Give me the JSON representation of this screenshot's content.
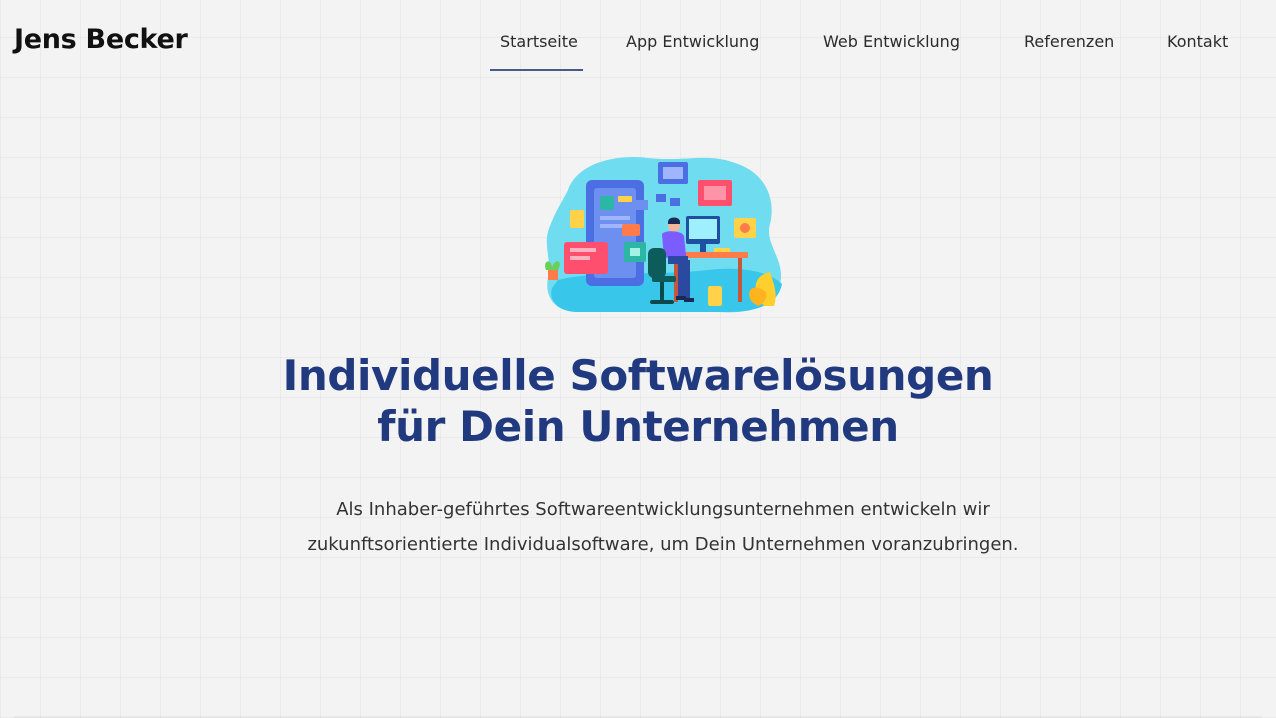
{
  "brand": {
    "name": "Jens Becker"
  },
  "nav": {
    "items": [
      {
        "label": "Startseite",
        "active": true
      },
      {
        "label": "App Entwicklung",
        "active": false
      },
      {
        "label": "Web Entwicklung",
        "active": false
      },
      {
        "label": "Referenzen",
        "active": false
      },
      {
        "label": "Kontakt",
        "active": false
      }
    ]
  },
  "hero": {
    "illustration": "developer-at-desk-illustration",
    "title_lines": [
      "Individuelle Softwarelösungen",
      "für Dein Unternehmen"
    ],
    "subtitle_lines": [
      "Als Inhaber-geführtes Softwareentwicklungsunternehmen entwickeln wir",
      "zukunftsorientierte Individualsoftware, um Dein Unternehmen voranzubringen."
    ]
  },
  "colors": {
    "background": "#f3f3f3",
    "title": "#21397f",
    "nav_active_underline": "#4a5a86",
    "brand_text": "#111111"
  }
}
